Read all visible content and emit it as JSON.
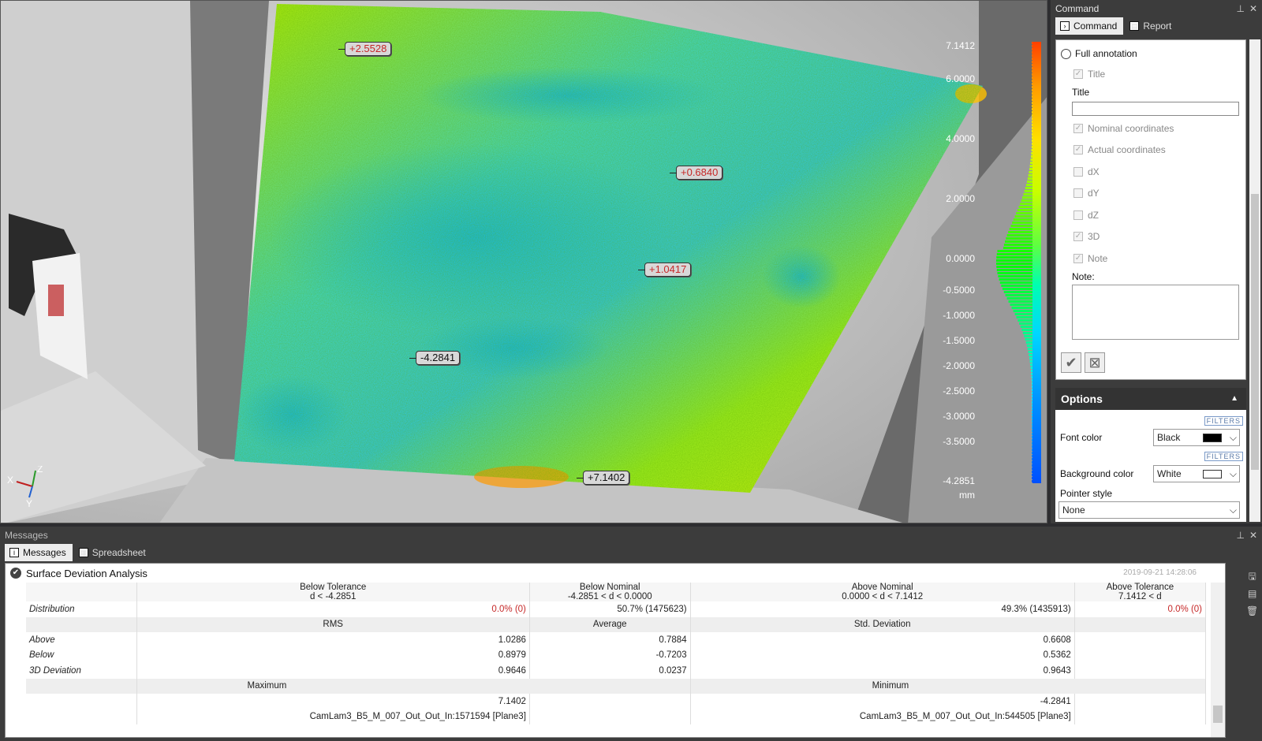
{
  "viewport": {
    "annotations": [
      {
        "value": "+2.5528",
        "tone": "red"
      },
      {
        "value": "+0.6840",
        "tone": "red"
      },
      {
        "value": "+1.0417",
        "tone": "red"
      },
      {
        "value": "-4.2841",
        "tone": "black"
      },
      {
        "value": "+7.1402",
        "tone": "black"
      }
    ],
    "scale_ticks": [
      "7.1412",
      "6.0000",
      "4.0000",
      "2.0000",
      "0.0000",
      "-0.5000",
      "-1.0000",
      "-1.5000",
      "-2.0000",
      "-2.5000",
      "-3.0000",
      "-3.5000",
      "-4.2851"
    ],
    "scale_unit": "mm",
    "axes": {
      "z": "Z",
      "x": "X",
      "y": "Y"
    },
    "colorbar_colors": [
      "#ff4000",
      "#ffe000",
      "#60ff40",
      "#00d8ff",
      "#0050ff"
    ]
  },
  "command_panel": {
    "title": "Command",
    "tabs": [
      {
        "label": "Command",
        "icon": "command-icon"
      },
      {
        "label": "Report",
        "icon": "report-icon"
      }
    ],
    "full_annotation": "Full annotation",
    "options_list": [
      {
        "label": "Title",
        "checked": true
      },
      {
        "label": "Nominal coordinates",
        "checked": true
      },
      {
        "label": "Actual coordinates",
        "checked": true
      },
      {
        "label": "dX",
        "checked": false
      },
      {
        "label": "dY",
        "checked": false
      },
      {
        "label": "dZ",
        "checked": false
      },
      {
        "label": "3D",
        "checked": true
      },
      {
        "label": "Note",
        "checked": true
      }
    ],
    "title_label": "Title",
    "title_value": "",
    "note_label": "Note:",
    "options_header": "Options",
    "filters": "FILTERS",
    "font_color_label": "Font color",
    "font_color_value": "Black",
    "font_color_hex": "#000000",
    "bg_color_label": "Background color",
    "bg_color_value": "White",
    "bg_color_hex": "#ffffff",
    "pointer_style_label": "Pointer style",
    "pointer_style_value": "None"
  },
  "messages_panel": {
    "title": "Messages",
    "tabs": [
      {
        "label": "Messages",
        "icon": "info-icon"
      },
      {
        "label": "Spreadsheet",
        "icon": "grid-icon"
      }
    ],
    "analysis_title": "Surface Deviation Analysis",
    "timestamp": "2019-09-21 14:28:06",
    "columns": [
      {
        "name": "Below Tolerance",
        "range": "d < -4.2851"
      },
      {
        "name": "Below Nominal",
        "range": "-4.2851 < d < 0.0000"
      },
      {
        "name": "Above Nominal",
        "range": "0.0000 < d < 7.1412"
      },
      {
        "name": "Above Tolerance",
        "range": "7.1412 < d"
      }
    ],
    "distribution": {
      "label": "Distribution",
      "values": [
        "0.0% (0)",
        "50.7% (1475623)",
        "49.3% (1435913)",
        "0.0% (0)"
      ]
    },
    "stats_headers": [
      "RMS",
      "Average",
      "Std. Deviation"
    ],
    "stats_rows": [
      {
        "label": "Above",
        "values": [
          "1.0286",
          "0.7884",
          "0.6608"
        ]
      },
      {
        "label": "Below",
        "values": [
          "0.8979",
          "-0.7203",
          "0.5362"
        ]
      },
      {
        "label": "3D Deviation",
        "values": [
          "0.9646",
          "0.0237",
          "0.9643"
        ]
      }
    ],
    "extreme_headers": [
      "Maximum",
      "Minimum"
    ],
    "maximum_value": "7.1402",
    "minimum_value": "-4.2841",
    "maximum_source": "CamLam3_B5_M_007_Out_Out_In:1571594 [Plane3]",
    "minimum_source": "CamLam3_B5_M_007_Out_Out_In:544505 [Plane3]"
  }
}
